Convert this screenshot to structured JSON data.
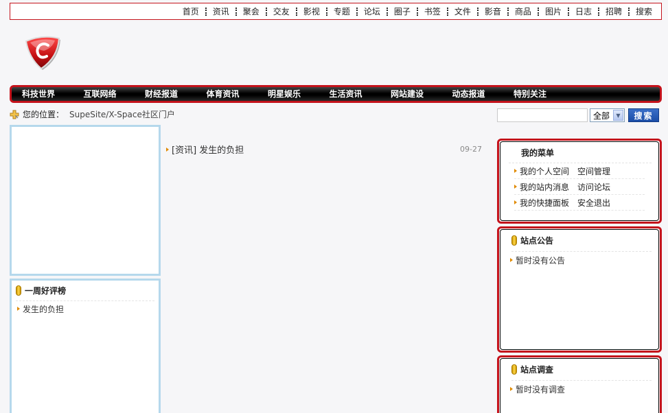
{
  "toplinks": [
    "首页",
    "资讯",
    "聚会",
    "交友",
    "影视",
    "专题",
    "论坛",
    "圈子",
    "书签",
    "文件",
    "影音",
    "商品",
    "图片",
    "日志",
    "招聘",
    "搜索"
  ],
  "nav": [
    "科技世界",
    "互联网络",
    "财经报道",
    "体育资讯",
    "明星娱乐",
    "生活资讯",
    "网站建设",
    "动态报道",
    "特别关注"
  ],
  "location": {
    "label": "您的位置：",
    "path": "SupeSite/X-Space社区门户"
  },
  "search": {
    "value": "",
    "select_value": "全部",
    "button": "搜索"
  },
  "rank": {
    "title": "一周好评榜",
    "items": [
      "发生的负担"
    ]
  },
  "articles": [
    {
      "title": "[资讯] 发生的负担",
      "date": "09-27"
    }
  ],
  "menu": {
    "title": "我的菜单",
    "rows": [
      [
        "我的个人空间",
        "空间管理"
      ],
      [
        "我的站内消息",
        "访问论坛"
      ],
      [
        "我的快捷面板",
        "安全退出"
      ]
    ]
  },
  "notice": {
    "title": "站点公告",
    "empty": "暂时没有公告"
  },
  "poll": {
    "title": "站点调查",
    "empty": "暂时没有调查"
  },
  "colors": {
    "accent": "#c4121b",
    "box_border": "#b5d8ec",
    "search_button": "#1b4ea8"
  }
}
